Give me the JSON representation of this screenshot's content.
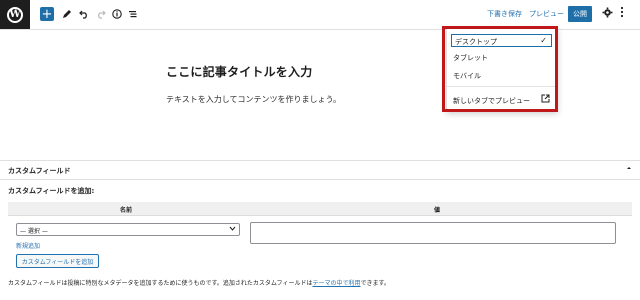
{
  "toolbar": {
    "logo_letter": "W",
    "add_symbol": "+",
    "icons": [
      "pen-icon",
      "undo-icon",
      "redo-icon",
      "info-icon",
      "list-view-icon"
    ],
    "draft_label": "下書き保存",
    "preview_label": "プレビュー",
    "publish_label": "公開",
    "colors": {
      "accent": "#1e6fa8",
      "link": "#2271b1"
    }
  },
  "editor": {
    "title_placeholder": "ここに記事タイトルを入力",
    "body_placeholder": "テキストを入力してコンテンツを作りましょう。"
  },
  "preview_menu": {
    "items": [
      "デスクトップ",
      "タブレット",
      "モバイル"
    ],
    "selected": "デスクトップ",
    "check": "✓",
    "new_tab_label": "新しいタブでプレビュー",
    "highlight_color": "#c0171b"
  },
  "custom_fields": {
    "panel_title": "カスタムフィールド",
    "add_label": "カスタムフィールドを追加:",
    "column_name": "名前",
    "column_value": "値",
    "select_value": "— 選択 —",
    "new_link": "新規追加",
    "add_button": "カスタムフィールドを追加",
    "help_before": "カスタムフィールドは投稿に特別なメタデータを追加するために使うものです。追加されたカスタムフィールドは",
    "help_link": "テーマの中で利用",
    "help_after": "できます。"
  }
}
